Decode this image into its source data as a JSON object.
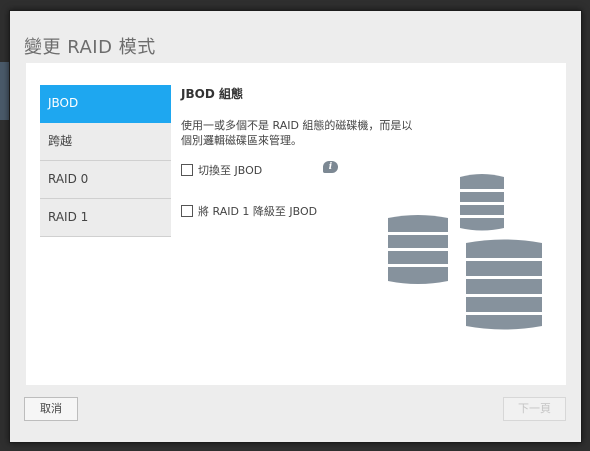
{
  "dialog": {
    "title": "變更 RAID 模式"
  },
  "nav": {
    "items": [
      {
        "label": "JBOD",
        "active": true
      },
      {
        "label": "跨越",
        "active": false
      },
      {
        "label": "RAID 0",
        "active": false
      },
      {
        "label": "RAID 1",
        "active": false
      }
    ]
  },
  "content": {
    "section_title": "JBOD 組態",
    "description": "使用一或多個不是 RAID 組態的磁碟機，而是以個別邏輯磁碟區來管理。",
    "options": [
      {
        "label": "切換至 JBOD",
        "checked": false
      },
      {
        "label": "將 RAID 1 降級至 JBOD",
        "checked": false
      }
    ],
    "info_icon_glyph": "i"
  },
  "footer": {
    "cancel_label": "取消",
    "next_label": "下一頁"
  },
  "colors": {
    "accent": "#1ea7f0",
    "disk": "#86929d"
  },
  "icons": [
    "info-icon",
    "disk-stack-icon"
  ]
}
